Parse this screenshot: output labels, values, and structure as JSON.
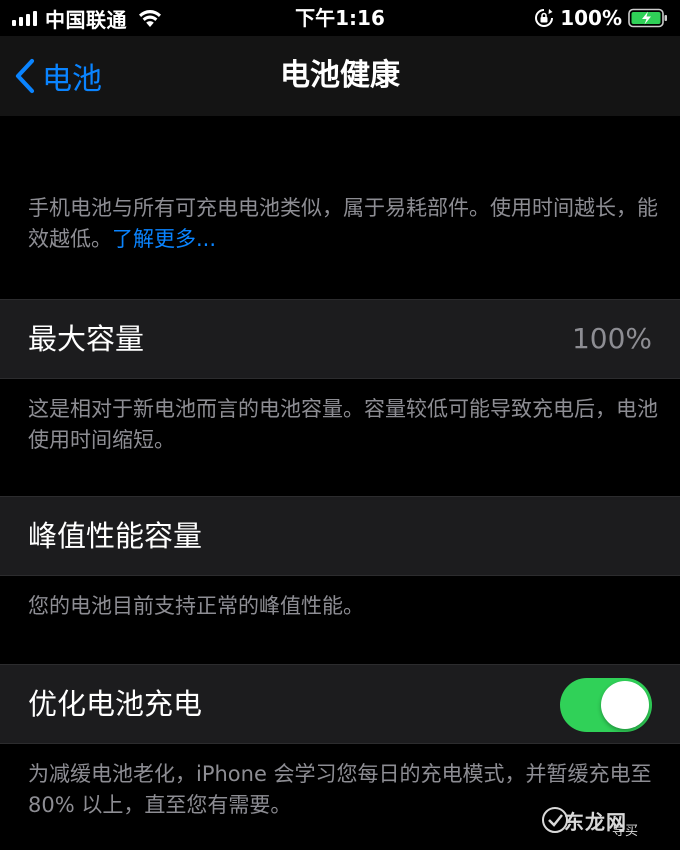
{
  "status_bar": {
    "carrier": "中国联通",
    "time": "下午1:16",
    "battery": "100%",
    "icons": [
      "signal-icon",
      "wifi-icon",
      "rotation-lock-icon",
      "battery-charging-icon"
    ]
  },
  "nav": {
    "back_label": "电池",
    "title": "电池健康",
    "back_icon": "chevron-left-icon"
  },
  "intro": {
    "text": "手机电池与所有可充电电池类似，属于易耗部件。使用时间越长，能效越低。",
    "link": "了解更多..."
  },
  "max_capacity": {
    "label": "最大容量",
    "value": "100%",
    "footer": "这是相对于新电池而言的电池容量。容量较低可能导致充电后，电池使用时间缩短。"
  },
  "peak_performance": {
    "label": "峰值性能容量",
    "footer": "您的电池目前支持正常的峰值性能。"
  },
  "optimized_charging": {
    "label": "优化电池充电",
    "enabled": true,
    "footer": "为减缓电池老化，iPhone 会学习您每日的充电模式，并暂缓充电至 80% 以上，直至您有需要。"
  },
  "watermark": {
    "text": "东龙网",
    "sub": "导买"
  },
  "colors": {
    "background": "#000000",
    "cell": "#1c1c1e",
    "accent": "#0a84ff",
    "toggle_on": "#30d158",
    "secondary_text": "#8d8d93"
  }
}
